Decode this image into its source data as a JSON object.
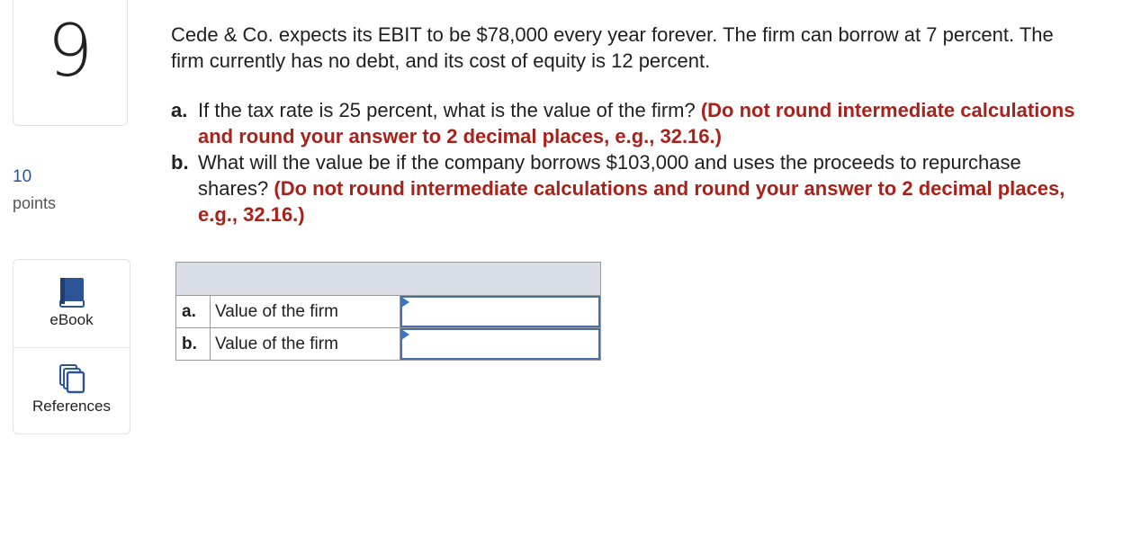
{
  "question_number": "9",
  "points": {
    "value": "10",
    "label": "points"
  },
  "tools": [
    {
      "label": "eBook",
      "icon": "book-icon"
    },
    {
      "label": "References",
      "icon": "copy-pages-icon"
    }
  ],
  "question_text": "Cede & Co. expects its EBIT to be $78,000 every year forever. The firm can borrow at 7 percent. The firm currently has no debt, and its cost of equity is 12 percent.",
  "parts": [
    {
      "letter": "a.",
      "text": "If the tax rate is 25 percent, what is the value of the firm? ",
      "note": "(Do not round intermediate calculations and round your answer to 2 decimal places, e.g., 32.16.)"
    },
    {
      "letter": "b.",
      "text": "What will the value be if the company borrows $103,000 and uses the proceeds to repurchase shares? ",
      "note": "(Do not round intermediate calculations and round your answer to 2 decimal places, e.g., 32.16.)"
    }
  ],
  "answer_table": {
    "rows": [
      {
        "letter": "a.",
        "label": "Value of the firm",
        "value": ""
      },
      {
        "letter": "b.",
        "label": "Value of the firm",
        "value": ""
      }
    ]
  },
  "colors": {
    "note": "#a8221b",
    "points": "#2554a6",
    "header_bg": "#d9dde6",
    "input_border": "#4a6ea9"
  }
}
